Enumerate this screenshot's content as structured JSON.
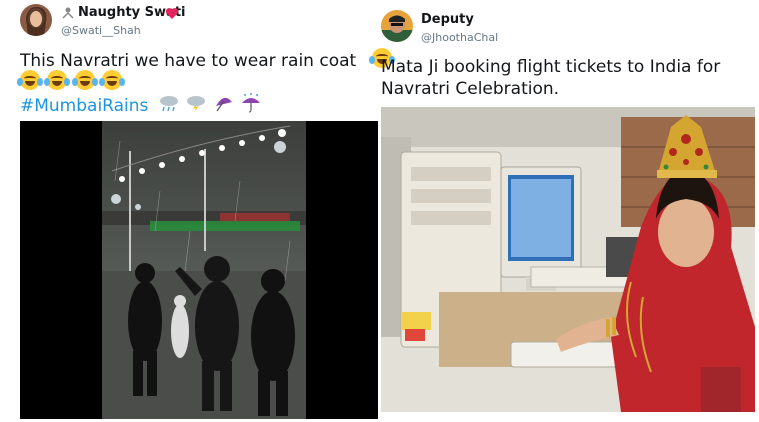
{
  "left_tweet": {
    "display_name": "Naughty Swati",
    "handle": "@Swati__Shah",
    "text_line1": "This Navratri we have to wear rain coat",
    "hashtag": "#MumbaiRains",
    "emoji_count_line2": 4,
    "accent_color": "#1b95e0",
    "heart_color": "#e0245e"
  },
  "right_tweet": {
    "display_name": "Deputy",
    "handle": "@JhoothaChal",
    "text_line1": "Mata Ji booking flight tickets to India for",
    "text_line2": "Navratri Celebration."
  }
}
